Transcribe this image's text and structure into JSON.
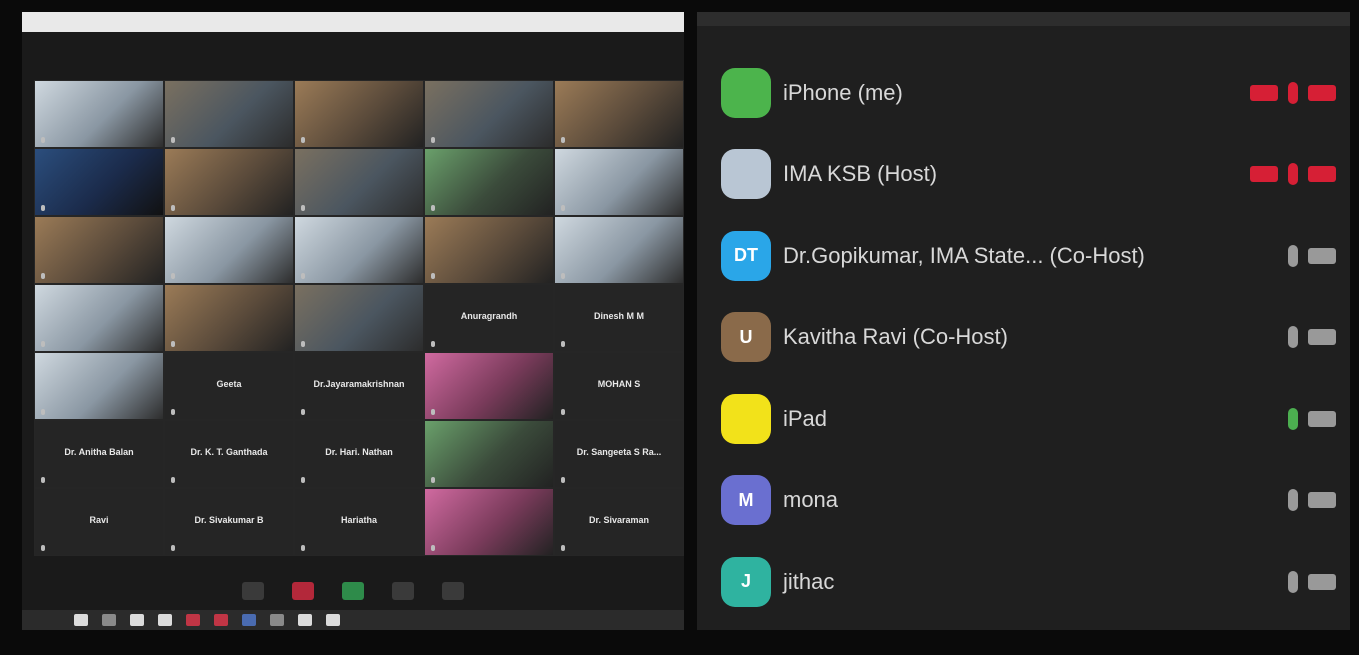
{
  "gallery": {
    "tiles": [
      {
        "name": "",
        "type": "video",
        "variant": "v2"
      },
      {
        "name": "",
        "type": "video",
        "variant": "v1"
      },
      {
        "name": "",
        "type": "video",
        "variant": "v3"
      },
      {
        "name": "",
        "type": "video",
        "variant": "v1"
      },
      {
        "name": "",
        "type": "video",
        "variant": "v3"
      },
      {
        "name": "",
        "type": "video",
        "variant": "v6"
      },
      {
        "name": "",
        "type": "video",
        "variant": "v3"
      },
      {
        "name": "",
        "type": "video",
        "variant": "v1"
      },
      {
        "name": "",
        "type": "video",
        "variant": "v4"
      },
      {
        "name": "",
        "type": "video",
        "variant": "v2"
      },
      {
        "name": "",
        "type": "video",
        "variant": "v3"
      },
      {
        "name": "",
        "type": "video",
        "variant": "v2"
      },
      {
        "name": "",
        "type": "video",
        "variant": "v2"
      },
      {
        "name": "",
        "type": "video",
        "variant": "v3"
      },
      {
        "name": "",
        "type": "video",
        "variant": "v2"
      },
      {
        "name": "",
        "type": "video",
        "variant": "v2"
      },
      {
        "name": "",
        "type": "video",
        "variant": "v3"
      },
      {
        "name": "",
        "type": "video",
        "variant": "v1"
      },
      {
        "name": "Anuragrandh",
        "type": "name"
      },
      {
        "name": "Dinesh M M",
        "type": "name"
      },
      {
        "name": "",
        "type": "video",
        "variant": "v2"
      },
      {
        "name": "Geeta",
        "type": "name"
      },
      {
        "name": "Dr.Jayaramakrishnan",
        "type": "name"
      },
      {
        "name": "",
        "type": "video",
        "variant": "v5"
      },
      {
        "name": "MOHAN S",
        "type": "name"
      },
      {
        "name": "Dr. Anitha Balan",
        "type": "name"
      },
      {
        "name": "Dr. K. T. Ganthada",
        "type": "name"
      },
      {
        "name": "Dr. Hari. Nathan",
        "type": "name"
      },
      {
        "name": "",
        "type": "video",
        "variant": "v4"
      },
      {
        "name": "Dr. Sangeeta S Ra...",
        "type": "name"
      },
      {
        "name": "Ravi",
        "type": "name"
      },
      {
        "name": "Dr. Sivakumar B",
        "type": "name"
      },
      {
        "name": "Hariatha",
        "type": "name"
      },
      {
        "name": "",
        "type": "video",
        "variant": "v5"
      },
      {
        "name": "Dr. Sivaraman",
        "type": "name"
      }
    ],
    "controls": [
      {
        "icon": "caret-icon",
        "tone": "dark"
      },
      {
        "icon": "camera-off-icon",
        "tone": "red"
      },
      {
        "icon": "share-screen-icon",
        "tone": "green"
      },
      {
        "icon": "record-icon",
        "tone": "dark"
      },
      {
        "icon": "reactions-icon",
        "tone": "dark"
      }
    ],
    "taskbar": [
      "w",
      "d",
      "w",
      "w",
      "r",
      "r",
      "b",
      "d",
      "w",
      "w"
    ]
  },
  "participants": [
    {
      "name": "iPhone (me)",
      "avatar_letter": "",
      "avatar_color": "#4cb44c",
      "mic": "red",
      "video": [
        "red"
      ],
      "extra": [
        "red"
      ]
    },
    {
      "name": "IMA KSB (Host)",
      "avatar_letter": "",
      "avatar_color": "#b9c6d4",
      "mic": "red",
      "video": [
        "red"
      ],
      "extra": [
        "red"
      ]
    },
    {
      "name": "Dr.Gopikumar, IMA State...   (Co-Host)",
      "avatar_letter": "DT",
      "avatar_color": "#2aa6e8",
      "mic": "grey",
      "video": [
        "grey"
      ],
      "extra": []
    },
    {
      "name": "Kavitha Ravi (Co-Host)",
      "avatar_letter": "U",
      "avatar_color": "#8a6a4a",
      "mic": "grey",
      "video": [
        "grey"
      ],
      "extra": []
    },
    {
      "name": "iPad",
      "avatar_letter": "",
      "avatar_color": "#f2e21a",
      "mic": "green",
      "video": [
        "grey"
      ],
      "extra": []
    },
    {
      "name": "mona",
      "avatar_letter": "M",
      "avatar_color": "#6a6fd0",
      "mic": "grey",
      "video": [
        "grey"
      ],
      "extra": []
    },
    {
      "name": "jithac",
      "avatar_letter": "J",
      "avatar_color": "#2fb3a0",
      "mic": "grey",
      "video": [
        "grey"
      ],
      "extra": []
    }
  ]
}
